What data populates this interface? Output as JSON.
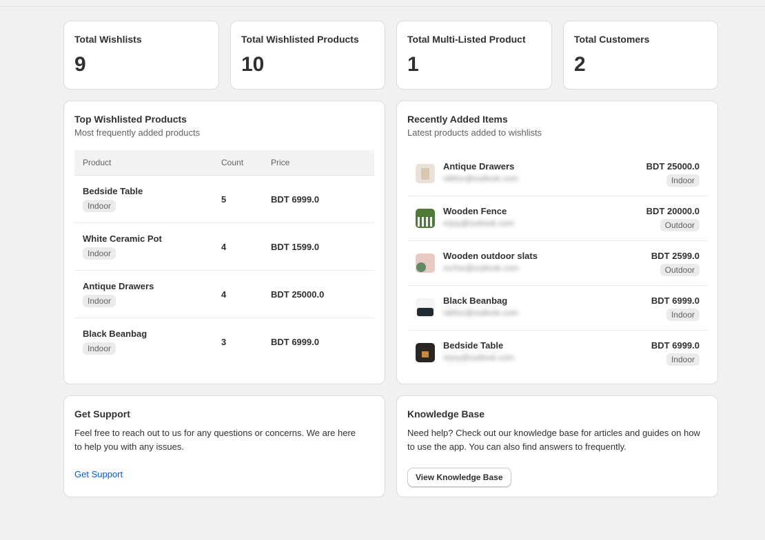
{
  "stats": [
    {
      "label": "Total Wishlists",
      "value": "9"
    },
    {
      "label": "Total Wishlisted Products",
      "value": "10"
    },
    {
      "label": "Total Multi-Listed Product",
      "value": "1"
    },
    {
      "label": "Total Customers",
      "value": "2"
    }
  ],
  "top_products": {
    "title": "Top Wishlisted Products",
    "subtitle": "Most frequently added products",
    "columns": [
      "Product",
      "Count",
      "Price"
    ],
    "rows": [
      {
        "name": "Bedside Table",
        "tag": "Indoor",
        "count": "5",
        "price": "BDT 6999.0"
      },
      {
        "name": "White Ceramic Pot",
        "tag": "Indoor",
        "count": "4",
        "price": "BDT 1599.0"
      },
      {
        "name": "Antique Drawers",
        "tag": "Indoor",
        "count": "4",
        "price": "BDT 25000.0"
      },
      {
        "name": "Black Beanbag",
        "tag": "Indoor",
        "count": "3",
        "price": "BDT 6999.0"
      }
    ]
  },
  "recent": {
    "title": "Recently Added Items",
    "subtitle": "Latest products added to wishlists",
    "items": [
      {
        "name": "Antique Drawers",
        "email": "nibfox@outlook.com",
        "price": "BDT 25000.0",
        "tag": "Indoor",
        "thumb_color": "#e8e2d8",
        "thumb_accent": "#d9c7b0"
      },
      {
        "name": "Wooden Fence",
        "email": "nrjoy@outlook.com",
        "price": "BDT 20000.0",
        "tag": "Outdoor",
        "thumb_color": "#4f7a3a",
        "thumb_accent": "#f2f2ee"
      },
      {
        "name": "Wooden outdoor slats",
        "email": "ncrfox@outlook.com",
        "price": "BDT 2599.0",
        "tag": "Outdoor",
        "thumb_color": "#e9c9c4",
        "thumb_accent": "#5f8a62"
      },
      {
        "name": "Black Beanbag",
        "email": "nibfox@outlook.com",
        "price": "BDT 6999.0",
        "tag": "Indoor",
        "thumb_color": "#f4f4f4",
        "thumb_accent": "#1f2a33"
      },
      {
        "name": "Bedside Table",
        "email": "nrjoy@outlook.com",
        "price": "BDT 6999.0",
        "tag": "Indoor",
        "thumb_color": "#2b2622",
        "thumb_accent": "#c78a3c"
      }
    ]
  },
  "support": {
    "title": "Get Support",
    "text": "Feel free to reach out to us for any questions or concerns. We are here to help you with any issues.",
    "link_label": "Get Support"
  },
  "knowledge": {
    "title": "Knowledge Base",
    "text": "Need help? Check out our knowledge base for articles and guides on how to use the app. You can also find answers to frequently.",
    "button_label": "View Knowledge Base"
  },
  "colors": {
    "background": "#f1f1f1",
    "card": "#ffffff",
    "link": "#005bd3",
    "badge": "#ebebeb"
  }
}
